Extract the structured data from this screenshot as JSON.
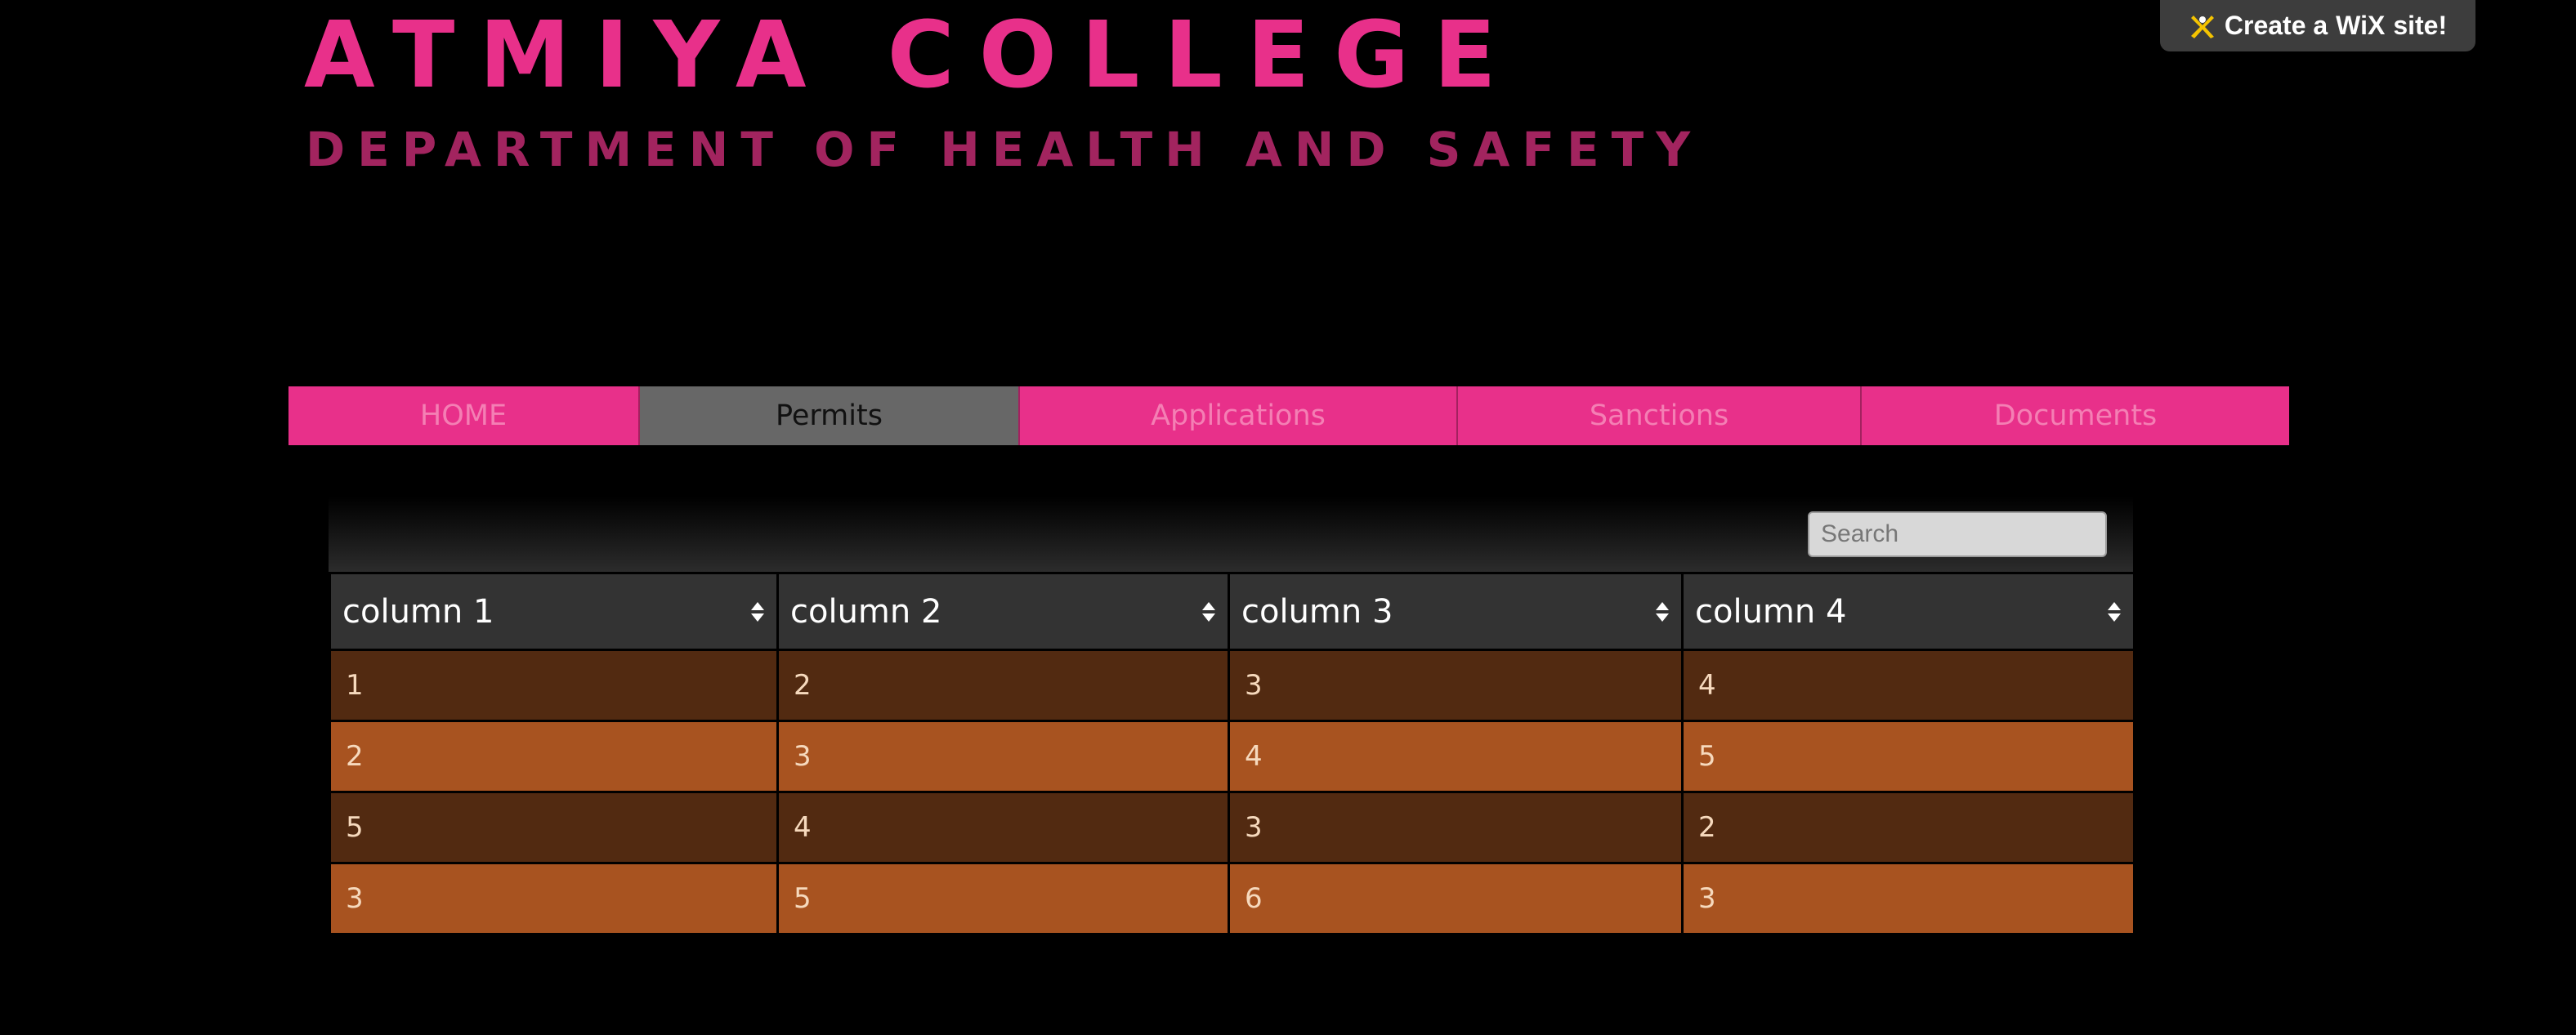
{
  "header": {
    "title": "ATMIYA COLLEGE",
    "subtitle": "DEPARTMENT OF HEALTH AND SAFETY"
  },
  "wix_banner": {
    "prefix": "Create a",
    "brand": "WiX",
    "suffix": "site!",
    "icon": "wix-logo-icon"
  },
  "nav": {
    "items": [
      {
        "label": "HOME"
      },
      {
        "label": "Permits"
      },
      {
        "label": "Applications"
      },
      {
        "label": "Sanctions"
      },
      {
        "label": "Documents"
      }
    ],
    "active": "Permits"
  },
  "table": {
    "search_placeholder": "Search",
    "columns": [
      "column 1",
      "column 2",
      "column 3",
      "column 4"
    ],
    "rows": [
      [
        "1",
        "2",
        "3",
        "4"
      ],
      [
        "2",
        "3",
        "4",
        "5"
      ],
      [
        "5",
        "4",
        "3",
        "2"
      ],
      [
        "3",
        "5",
        "6",
        "3"
      ]
    ]
  },
  "colors": {
    "accent_pink": "#e8308a",
    "subtitle_pink": "#a2245f",
    "nav_active": "#676767",
    "row_dark": "#522a11",
    "row_light": "#a85320",
    "header_cell": "#333333"
  }
}
